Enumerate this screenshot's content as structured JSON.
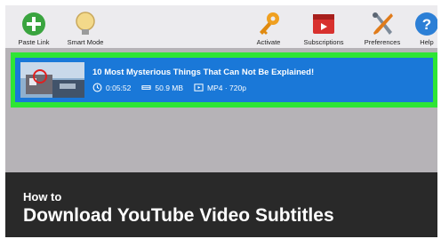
{
  "toolbar": {
    "paste_link": "Paste Link",
    "smart_mode": "Smart Mode",
    "activate": "Activate",
    "subscriptions": "Subscriptions",
    "preferences": "Preferences",
    "help": "Help"
  },
  "download_item": {
    "title": "10 Most Mysterious Things That Can Not Be Explained!",
    "duration": "0:05:52",
    "size": "50.9 MB",
    "format": "MP4 · 720p"
  },
  "caption": {
    "line1": "How to",
    "line2": "Download YouTube Video Subtitles"
  },
  "colors": {
    "selection": "#1a78d8",
    "highlight": "#2ee535",
    "caption_bg": "#292929"
  }
}
